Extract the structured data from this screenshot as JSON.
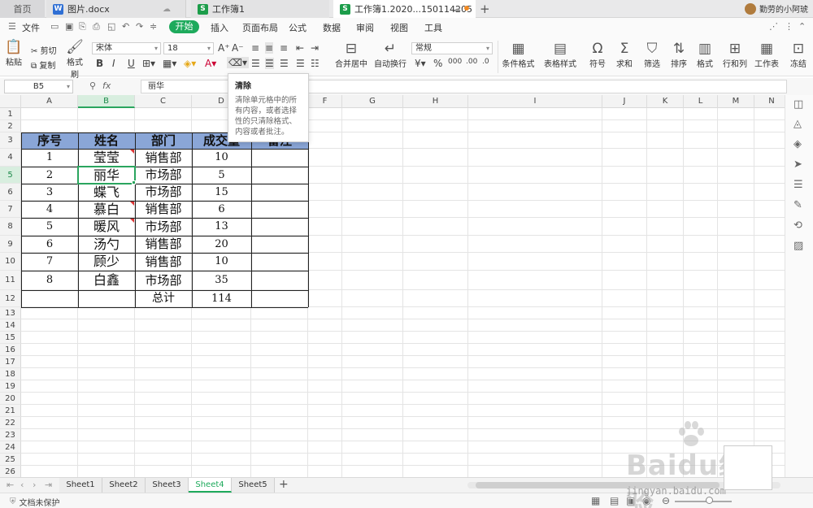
{
  "titlebar": {
    "home_tab": "首页",
    "tab1": "图片.docx",
    "tab2": "工作簿1",
    "tab3": "工作簿1.2020...150114205",
    "new_tab": "+",
    "user_name": "勤劳的小阿琥"
  },
  "menu": {
    "file": "文件",
    "start": "开始",
    "items": [
      "插入",
      "页面布局",
      "公式",
      "数据",
      "审阅",
      "视图",
      "工具"
    ]
  },
  "ribbon": {
    "paste": "粘贴",
    "cut": "剪切",
    "copy": "复制",
    "format_painter": "格式刷",
    "font_name": "宋体",
    "font_size": "18",
    "bold": "B",
    "italic": "I",
    "underline": "U",
    "merge": "合并居中",
    "wrap": "自动换行",
    "number_format": "常规",
    "percent": "%",
    "cond_format": "条件格式",
    "table_style": "表格样式",
    "symbol": "符号",
    "sum": "求和",
    "filter": "筛选",
    "sort": "排序",
    "format": "格式",
    "rowcol": "行和列",
    "worksheet": "工作表",
    "freeze": "冻结"
  },
  "formula_bar": {
    "name_box": "B5",
    "fx": "fx",
    "value": "丽华"
  },
  "tooltip": {
    "title": "清除",
    "body": "清除单元格中的所有内容，或者选择性的只清除格式、内容或者批注。"
  },
  "grid": {
    "columns": [
      "A",
      "B",
      "C",
      "D",
      "E",
      "F",
      "G",
      "H",
      "I",
      "J",
      "K",
      "L",
      "M",
      "N"
    ],
    "rows": [
      "1",
      "2",
      "3",
      "4",
      "5",
      "6",
      "7",
      "8",
      "9",
      "10",
      "11",
      "12",
      "13",
      "14",
      "15",
      "16",
      "17",
      "18",
      "19",
      "20",
      "21",
      "22",
      "23",
      "24",
      "25",
      "26"
    ],
    "table_headers": [
      "序号",
      "姓名",
      "部门",
      "成交量",
      "备注"
    ],
    "table_rows": [
      [
        "1",
        "莹莹",
        "销售部",
        "10",
        ""
      ],
      [
        "2",
        "丽华",
        "市场部",
        "5",
        ""
      ],
      [
        "3",
        "蝶飞",
        "市场部",
        "15",
        ""
      ],
      [
        "4",
        "慕白",
        "销售部",
        "6",
        ""
      ],
      [
        "5",
        "暖风",
        "市场部",
        "13",
        ""
      ],
      [
        "6",
        "汤勺",
        "销售部",
        "20",
        ""
      ],
      [
        "7",
        "顾少",
        "销售部",
        "10",
        ""
      ],
      [
        "8",
        "白鑫",
        "市场部",
        "35",
        ""
      ]
    ],
    "total_label": "总计",
    "total_value": "114"
  },
  "sheets": [
    "Sheet1",
    "Sheet2",
    "Sheet3",
    "Sheet4",
    "Sheet5"
  ],
  "active_sheet": "Sheet4",
  "status": {
    "protect": "文档未保护"
  },
  "watermark": {
    "text": "Baidu经验",
    "url": "jingyan.baidu.com"
  },
  "colors": {
    "accent": "#1eaa5c",
    "header_fill": "#8aa6d7",
    "selection": "#2aa55e"
  }
}
